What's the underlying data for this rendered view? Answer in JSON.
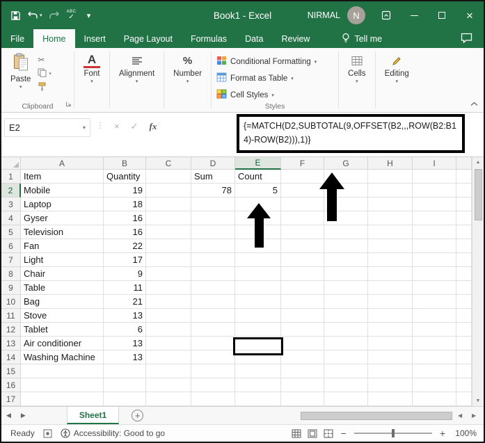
{
  "colors": {
    "excel_green": "#217346",
    "selected_header_bg": "#dfe6e0",
    "grid_line": "#e0e0e0",
    "annotation": "#000000"
  },
  "icons": {
    "caret_down": "▾",
    "cancel": "×",
    "enter": "✓",
    "handle": "⋮",
    "scissors": "✂",
    "nav_left": "◀",
    "nav_right": "▶",
    "scroll_up": "▲",
    "scroll_down": "▼",
    "add": "+",
    "zoom_out": "−",
    "zoom_in": "+",
    "close": "×"
  },
  "title_bar": {
    "title": "Book1 - Excel",
    "user_name": "NIRMAL",
    "avatar_initial": "N",
    "quick_access": {
      "spelling": "ABC"
    }
  },
  "ribbon_tabs": {
    "items": [
      "File",
      "Home",
      "Insert",
      "Page Layout",
      "Formulas",
      "Data",
      "Review"
    ],
    "active": "Home",
    "tell_me": "Tell me"
  },
  "ribbon": {
    "paste_label": "Paste",
    "clipboard_group": "Clipboard",
    "font_label": "Font",
    "alignment_label": "Alignment",
    "number_label": "Number",
    "conditional_formatting": "Conditional Formatting",
    "format_as_table": "Format as Table",
    "cell_styles": "Cell Styles",
    "styles_group": "Styles",
    "cells_label": "Cells",
    "editing_label": "Editing"
  },
  "formula_bar": {
    "name_box": "E2",
    "fx_label": "fx",
    "formula": "{=MATCH(D2,SUBTOTAL(9,OFFSET(B2,,,ROW(B2:B14)-ROW(B2))),1)}"
  },
  "grid": {
    "col_headers": [
      "A",
      "B",
      "C",
      "D",
      "E",
      "F",
      "G",
      "H",
      "I"
    ],
    "selected_col": "E",
    "selected_row": "2",
    "selected_cell": "E2",
    "rows": [
      {
        "n": "1",
        "cells": {
          "A": "Item",
          "B": "Quantity",
          "D": "Sum",
          "E": "Count"
        }
      },
      {
        "n": "2",
        "cells": {
          "A": "Mobile",
          "B": "19",
          "D": "78",
          "E": "5"
        }
      },
      {
        "n": "3",
        "cells": {
          "A": "Laptop",
          "B": "18"
        }
      },
      {
        "n": "4",
        "cells": {
          "A": "Gyser",
          "B": "16"
        }
      },
      {
        "n": "5",
        "cells": {
          "A": "Television",
          "B": "16"
        }
      },
      {
        "n": "6",
        "cells": {
          "A": "Fan",
          "B": "22"
        }
      },
      {
        "n": "7",
        "cells": {
          "A": "Light",
          "B": "17"
        }
      },
      {
        "n": "8",
        "cells": {
          "A": "Chair",
          "B": "9"
        }
      },
      {
        "n": "9",
        "cells": {
          "A": "Table",
          "B": "11"
        }
      },
      {
        "n": "10",
        "cells": {
          "A": "Bag",
          "B": "21"
        }
      },
      {
        "n": "11",
        "cells": {
          "A": "Stove",
          "B": "13"
        }
      },
      {
        "n": "12",
        "cells": {
          "A": "Tablet",
          "B": "6"
        }
      },
      {
        "n": "13",
        "cells": {
          "A": "Air conditioner",
          "B": "13"
        }
      },
      {
        "n": "14",
        "cells": {
          "A": "Washing Machine",
          "B": "13"
        }
      },
      {
        "n": "15",
        "cells": {}
      },
      {
        "n": "16",
        "cells": {}
      },
      {
        "n": "17",
        "cells": {}
      }
    ]
  },
  "sheet_bar": {
    "active_tab": "Sheet1"
  },
  "status_bar": {
    "mode": "Ready",
    "accessibility": "Accessibility: Good to go",
    "zoom_level": "100%"
  }
}
